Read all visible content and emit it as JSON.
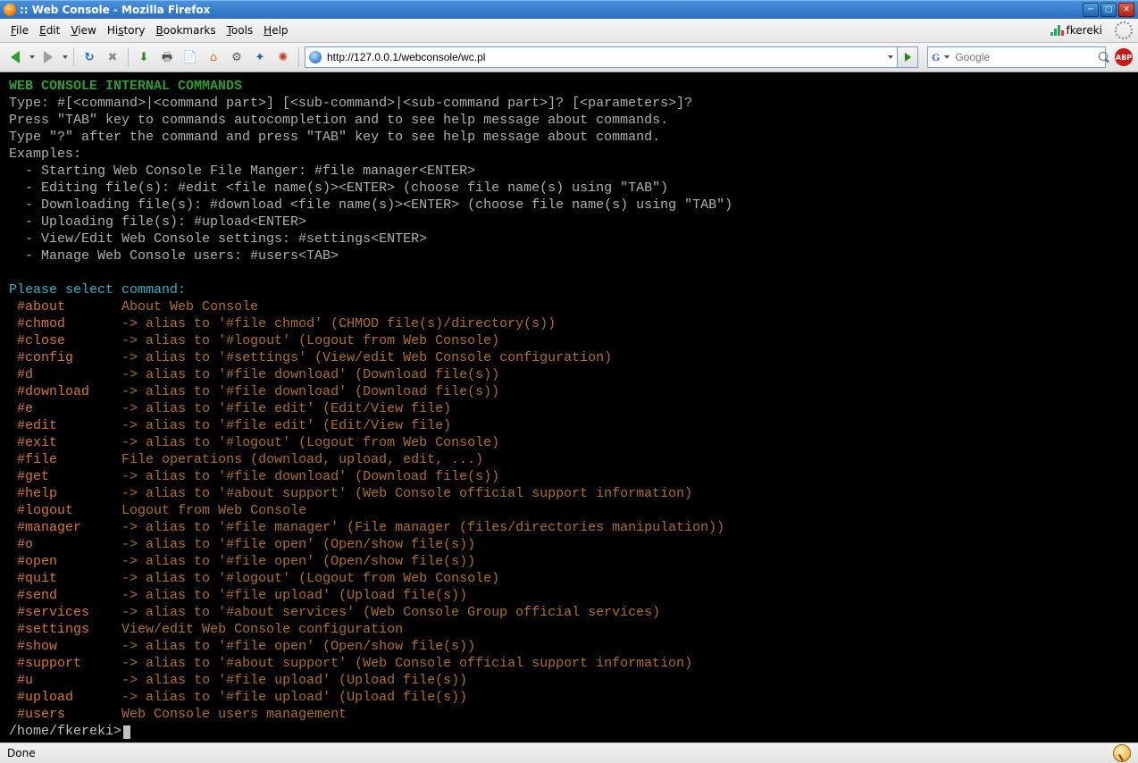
{
  "window": {
    "title": ":: Web Console - Mozilla Firefox"
  },
  "menu": {
    "items": [
      {
        "label": "File",
        "accel": "F"
      },
      {
        "label": "Edit",
        "accel": "E"
      },
      {
        "label": "View",
        "accel": "V"
      },
      {
        "label": "History",
        "accel": "s"
      },
      {
        "label": "Bookmarks",
        "accel": "B"
      },
      {
        "label": "Tools",
        "accel": "T"
      },
      {
        "label": "Help",
        "accel": "H"
      }
    ],
    "user_label": "fkereki"
  },
  "toolbar": {
    "address": "http://127.0.0.1/webconsole/wc.pl",
    "search_placeholder": "Google",
    "abp_label": "ABP"
  },
  "console": {
    "header": "WEB CONSOLE INTERNAL COMMANDS",
    "intro": [
      "Type: #[<command>|<command part>] [<sub-command>|<sub-command part>]? [<parameters>]?",
      "Press \"TAB\" key to commands autocompletion and to see help message about commands.",
      "Type \"?\" after the command and press \"TAB\" key to see help message about command.",
      "Examples:",
      "  - Starting Web Console File Manger: #file manager<ENTER>",
      "  - Editing file(s): #edit <file name(s)><ENTER> (choose file name(s) using \"TAB\")",
      "  - Downloading file(s): #download <file name(s)><ENTER> (choose file name(s) using \"TAB\")",
      "  - Uploading file(s): #upload<ENTER>",
      "  - View/Edit Web Console settings: #settings<ENTER>",
      "  - Manage Web Console users: #users<TAB>"
    ],
    "select_prompt": "Please select command:",
    "commands": [
      {
        "cmd": "#about",
        "desc": "About Web Console"
      },
      {
        "cmd": "#chmod",
        "desc": "-> alias to '#file chmod' (CHMOD file(s)/directory(s))"
      },
      {
        "cmd": "#close",
        "desc": "-> alias to '#logout' (Logout from Web Console)"
      },
      {
        "cmd": "#config",
        "desc": "-> alias to '#settings' (View/edit Web Console configuration)"
      },
      {
        "cmd": "#d",
        "desc": "-> alias to '#file download' (Download file(s))"
      },
      {
        "cmd": "#download",
        "desc": "-> alias to '#file download' (Download file(s))"
      },
      {
        "cmd": "#e",
        "desc": "-> alias to '#file edit' (Edit/View file)"
      },
      {
        "cmd": "#edit",
        "desc": "-> alias to '#file edit' (Edit/View file)"
      },
      {
        "cmd": "#exit",
        "desc": "-> alias to '#logout' (Logout from Web Console)"
      },
      {
        "cmd": "#file",
        "desc": "File operations (download, upload, edit, ...)"
      },
      {
        "cmd": "#get",
        "desc": "-> alias to '#file download' (Download file(s))"
      },
      {
        "cmd": "#help",
        "desc": "-> alias to '#about support' (Web Console official support information)"
      },
      {
        "cmd": "#logout",
        "desc": "Logout from Web Console"
      },
      {
        "cmd": "#manager",
        "desc": "-> alias to '#file manager' (File manager (files/directories manipulation))"
      },
      {
        "cmd": "#o",
        "desc": "-> alias to '#file open' (Open/show file(s))"
      },
      {
        "cmd": "#open",
        "desc": "-> alias to '#file open' (Open/show file(s))"
      },
      {
        "cmd": "#quit",
        "desc": "-> alias to '#logout' (Logout from Web Console)"
      },
      {
        "cmd": "#send",
        "desc": "-> alias to '#file upload' (Upload file(s))"
      },
      {
        "cmd": "#services",
        "desc": "-> alias to '#about services' (Web Console Group official services)"
      },
      {
        "cmd": "#settings",
        "desc": "View/edit Web Console configuration"
      },
      {
        "cmd": "#show",
        "desc": "-> alias to '#file open' (Open/show file(s))"
      },
      {
        "cmd": "#support",
        "desc": "-> alias to '#about support' (Web Console official support information)"
      },
      {
        "cmd": "#u",
        "desc": "-> alias to '#file upload' (Upload file(s))"
      },
      {
        "cmd": "#upload",
        "desc": "-> alias to '#file upload' (Upload file(s))"
      },
      {
        "cmd": "#users",
        "desc": "Web Console users management"
      }
    ],
    "prompt": "/home/fkereki>"
  },
  "status": {
    "text": "Done"
  }
}
